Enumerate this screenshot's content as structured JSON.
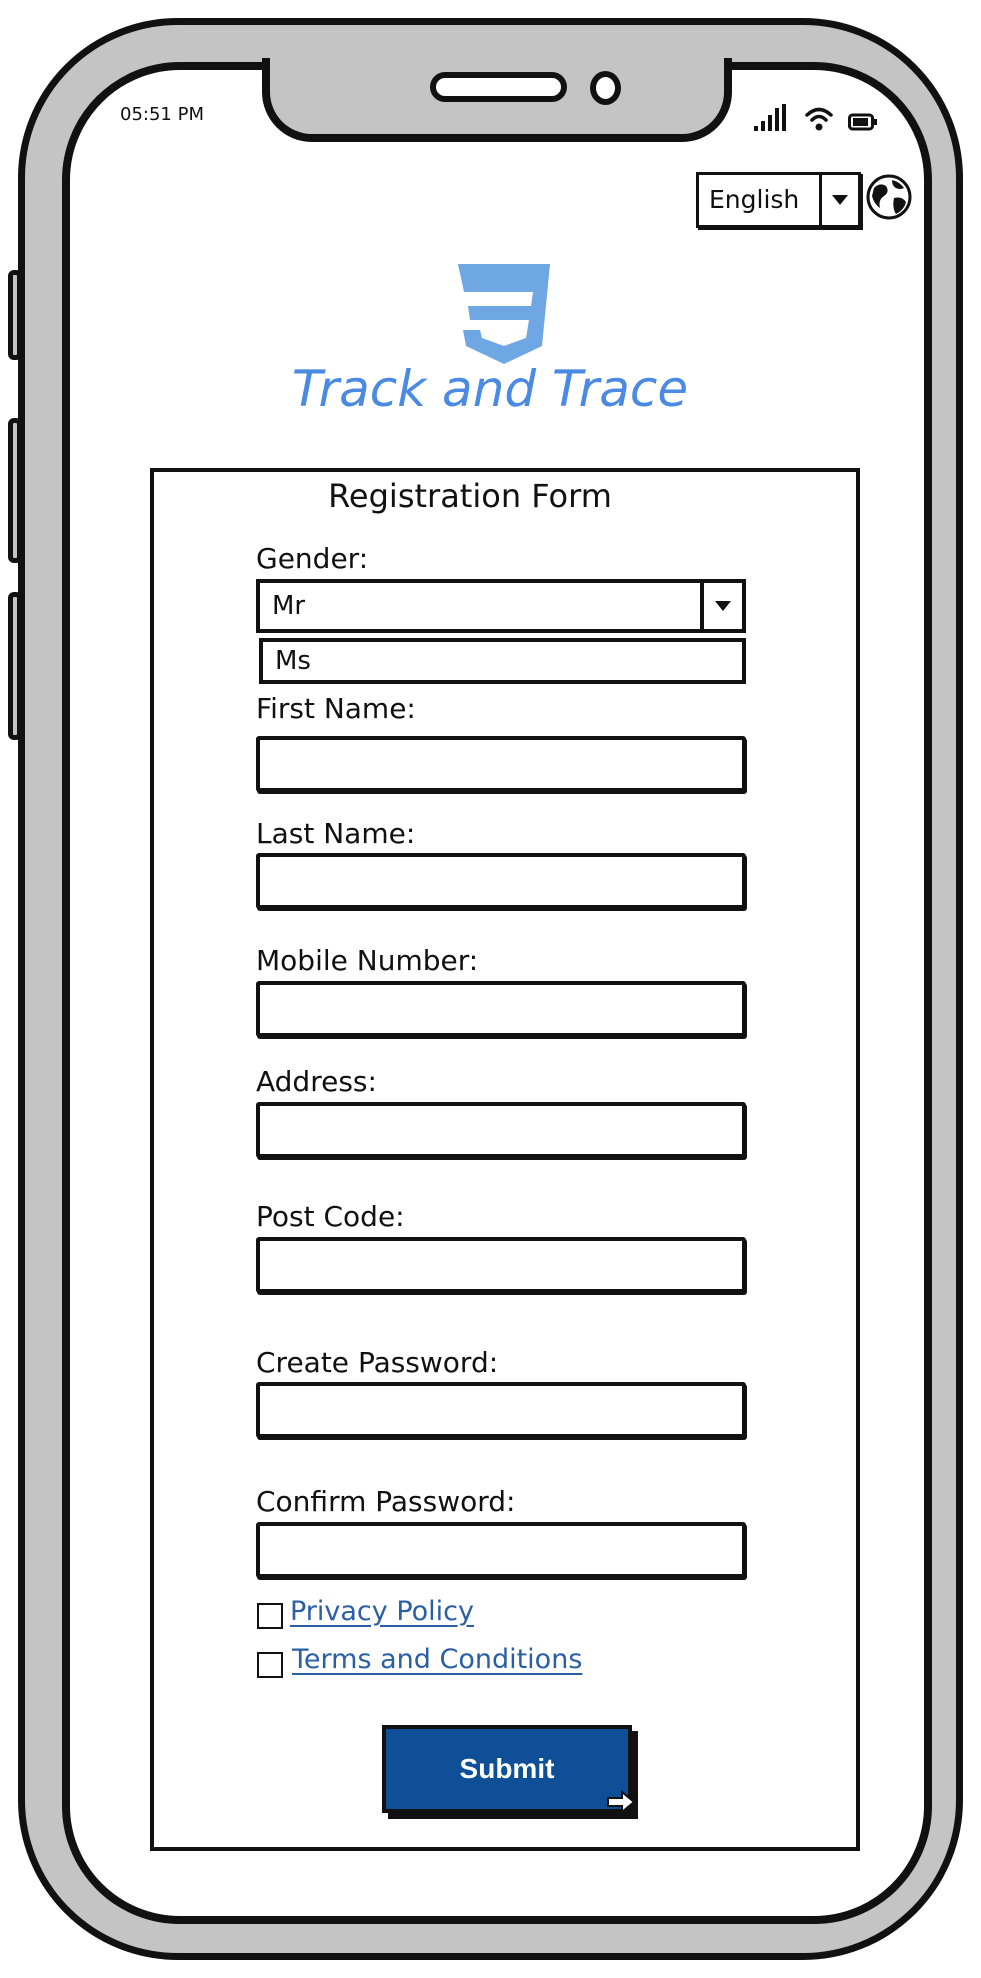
{
  "status_bar": {
    "time": "05:51 PM",
    "icons": [
      "signal-icon",
      "wifi-icon",
      "battery-icon"
    ]
  },
  "language": {
    "selected": "English",
    "icon": "globe-icon"
  },
  "app": {
    "logo": "css3-shield-logo",
    "title": "Track and Trace"
  },
  "form": {
    "title": "Registration Form",
    "gender": {
      "label": "Gender:",
      "selected": "Mr",
      "options": [
        "Ms"
      ]
    },
    "fields": [
      {
        "label": "First Name:",
        "value": ""
      },
      {
        "label": "Last Name:",
        "value": ""
      },
      {
        "label": "Mobile Number:",
        "value": ""
      },
      {
        "label": "Address:",
        "value": ""
      },
      {
        "label": "Post Code:",
        "value": ""
      },
      {
        "label": "Create Password:",
        "value": ""
      },
      {
        "label": "Confirm Password:",
        "value": ""
      }
    ],
    "privacy_label": "Privacy Policy",
    "terms_label": "Terms and Conditions",
    "submit_label": "Submit"
  },
  "colors": {
    "accent": "#4a8ae2",
    "button": "#0e4f97",
    "link": "#2a5fa6",
    "frame": "#c4c4c4"
  }
}
